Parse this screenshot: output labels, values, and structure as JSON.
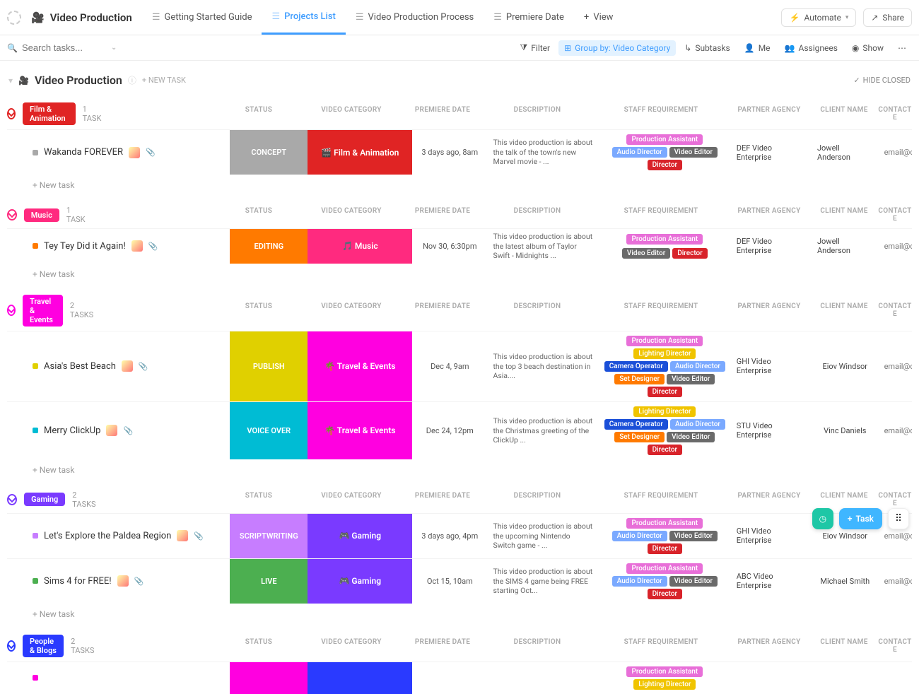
{
  "colors": {
    "film": "#e02424",
    "music": "#ff2a7f",
    "travel": "#ff00e0",
    "gaming": "#7a3aff",
    "people": "#2a3aff",
    "concept": "#a9a9a9",
    "editing": "#ff7a00",
    "publish": "#e0d000",
    "voiceover": "#00bcd4",
    "script": "#c77dff",
    "live": "#4caf50",
    "chip_pa": "#e86fd8",
    "chip_ad": "#7aa9ff",
    "chip_ve": "#6a6a6a",
    "chip_dir": "#d8232a",
    "chip_ld": "#f0c400",
    "chip_co": "#1a4fd8",
    "chip_sd": "#ff7a00"
  },
  "header": {
    "title": "Video Production",
    "tabs": [
      {
        "label": "Getting Started Guide"
      },
      {
        "label": "Projects List",
        "active": true
      },
      {
        "label": "Video Production Process"
      },
      {
        "label": "Premiere Date"
      },
      {
        "label": "View",
        "isAdd": true
      }
    ],
    "automate": "Automate",
    "share": "Share"
  },
  "toolbar": {
    "search_placeholder": "Search tasks...",
    "filter": "Filter",
    "group_by": "Group by: Video Category",
    "subtasks": "Subtasks",
    "me": "Me",
    "assignees": "Assignees",
    "show": "Show"
  },
  "section": {
    "title": "Video Production",
    "new_task": "+ NEW TASK",
    "hide_closed": "HIDE CLOSED"
  },
  "columns": [
    "STATUS",
    "VIDEO CATEGORY",
    "PREMIERE DATE",
    "DESCRIPTION",
    "STAFF REQUIREMENT",
    "PARTNER AGENCY",
    "CLIENT NAME",
    "CONTACT E"
  ],
  "new_task_label": "+ New task",
  "task_button": "Task",
  "groups": [
    {
      "label": "Film & Animation",
      "pill_color": "film",
      "count": "1 TASK",
      "collapse_color": "#e02424",
      "tasks": [
        {
          "sq": "#a9a9a9",
          "name": "Wakanda FOREVER",
          "status": "CONCEPT",
          "status_color": "concept",
          "cat": "🎬 Film & Animation",
          "cat_color": "film",
          "date": "3 days ago, 8am",
          "desc": "This video production is about the talk of the town's new Marvel movie - ...",
          "staff": [
            [
              "Production Assistant",
              "chip_pa"
            ],
            [
              "Audio Director",
              "chip_ad"
            ],
            [
              "Video Editor",
              "chip_ve"
            ],
            [
              "Director",
              "chip_dir"
            ]
          ],
          "agency": "DEF Video Enterprise",
          "client": "Jowell Anderson",
          "contact": "email@cl"
        }
      ]
    },
    {
      "label": "Music",
      "pill_color": "music",
      "count": "1 TASK",
      "collapse_color": "#ff2a7f",
      "tasks": [
        {
          "sq": "#ff7a00",
          "name": "Tey Tey Did it Again!",
          "status": "EDITING",
          "status_color": "editing",
          "cat": "🎵 Music",
          "cat_color": "music",
          "date": "Nov 30, 6:30pm",
          "desc": "This video production is about the latest album of Taylor Swift - Midnights ...",
          "staff": [
            [
              "Production Assistant",
              "chip_pa"
            ],
            [
              "Video Editor",
              "chip_ve"
            ],
            [
              "Director",
              "chip_dir"
            ]
          ],
          "agency": "DEF Video Enterprise",
          "client": "Jowell Anderson",
          "contact": "email@cl"
        }
      ]
    },
    {
      "label": "Travel & Events",
      "pill_color": "travel",
      "count": "2 TASKS",
      "collapse_color": "#ff00e0",
      "tasks": [
        {
          "sq": "#e0d000",
          "name": "Asia's Best Beach",
          "status": "PUBLISH",
          "status_color": "publish",
          "cat": "🌴 Travel & Events",
          "cat_color": "travel",
          "date": "Dec 4, 9am",
          "desc": "This video production is about the top 3 beach destination in Asia....",
          "staff": [
            [
              "Production Assistant",
              "chip_pa"
            ],
            [
              "Lighting Director",
              "chip_ld"
            ],
            [
              "Camera Operator",
              "chip_co"
            ],
            [
              "Audio Director",
              "chip_ad"
            ],
            [
              "Set Designer",
              "chip_sd"
            ],
            [
              "Video Editor",
              "chip_ve"
            ],
            [
              "Director",
              "chip_dir"
            ]
          ],
          "agency": "GHI Video Enterprise",
          "client": "Eiov Windsor",
          "contact": "email@cl"
        },
        {
          "sq": "#00bcd4",
          "name": "Merry ClickUp",
          "status": "VOICE OVER",
          "status_color": "voiceover",
          "cat": "🌴 Travel & Events",
          "cat_color": "travel",
          "date": "Dec 24, 12pm",
          "desc": "This video production is about the Christmas greeting of the ClickUp ...",
          "staff": [
            [
              "Lighting Director",
              "chip_ld"
            ],
            [
              "Camera Operator",
              "chip_co"
            ],
            [
              "Audio Director",
              "chip_ad"
            ],
            [
              "Set Designer",
              "chip_sd"
            ],
            [
              "Video Editor",
              "chip_ve"
            ],
            [
              "Director",
              "chip_dir"
            ]
          ],
          "agency": "STU Video Enterprise",
          "client": "Vinc Daniels",
          "contact": "email@cl"
        }
      ]
    },
    {
      "label": "Gaming",
      "pill_color": "gaming",
      "count": "2 TASKS",
      "collapse_color": "#7a3aff",
      "tasks": [
        {
          "sq": "#c77dff",
          "name": "Let's Explore the Paldea Region",
          "status": "SCRIPTWRITING",
          "status_color": "script",
          "cat": "🎮 Gaming",
          "cat_color": "gaming",
          "date": "3 days ago, 4pm",
          "desc": "This video production is about the upcoming Nintendo Switch game - ...",
          "staff": [
            [
              "Production Assistant",
              "chip_pa"
            ],
            [
              "Audio Director",
              "chip_ad"
            ],
            [
              "Video Editor",
              "chip_ve"
            ],
            [
              "Director",
              "chip_dir"
            ]
          ],
          "agency": "GHI Video Enterprise",
          "client": "Eiov Windsor",
          "contact": "email@cl"
        },
        {
          "sq": "#4caf50",
          "name": "Sims 4 for FREE!",
          "status": "LIVE",
          "status_color": "live",
          "cat": "🎮 Gaming",
          "cat_color": "gaming",
          "date": "Oct 15, 10am",
          "desc": "This video production is about the SIMS 4 game being FREE starting Oct...",
          "staff": [
            [
              "Production Assistant",
              "chip_pa"
            ],
            [
              "Audio Director",
              "chip_ad"
            ],
            [
              "Video Editor",
              "chip_ve"
            ],
            [
              "Director",
              "chip_dir"
            ]
          ],
          "agency": "ABC Video Enterprise",
          "client": "Michael Smith",
          "contact": "email@cl"
        }
      ]
    },
    {
      "label": "People & Blogs",
      "pill_color": "people",
      "count": "2 TASKS",
      "collapse_color": "#2a3aff",
      "tasks": [
        {
          "sq": "#ff00e0",
          "name": "",
          "status": "",
          "status_color": "travel",
          "cat": "",
          "cat_color": "people",
          "date": "",
          "desc": "",
          "staff": [
            [
              "Production Assistant",
              "chip_pa"
            ],
            [
              "Lighting Director",
              "chip_ld"
            ]
          ],
          "agency": "",
          "client": "",
          "contact": ""
        }
      ],
      "cutoff": true
    }
  ]
}
